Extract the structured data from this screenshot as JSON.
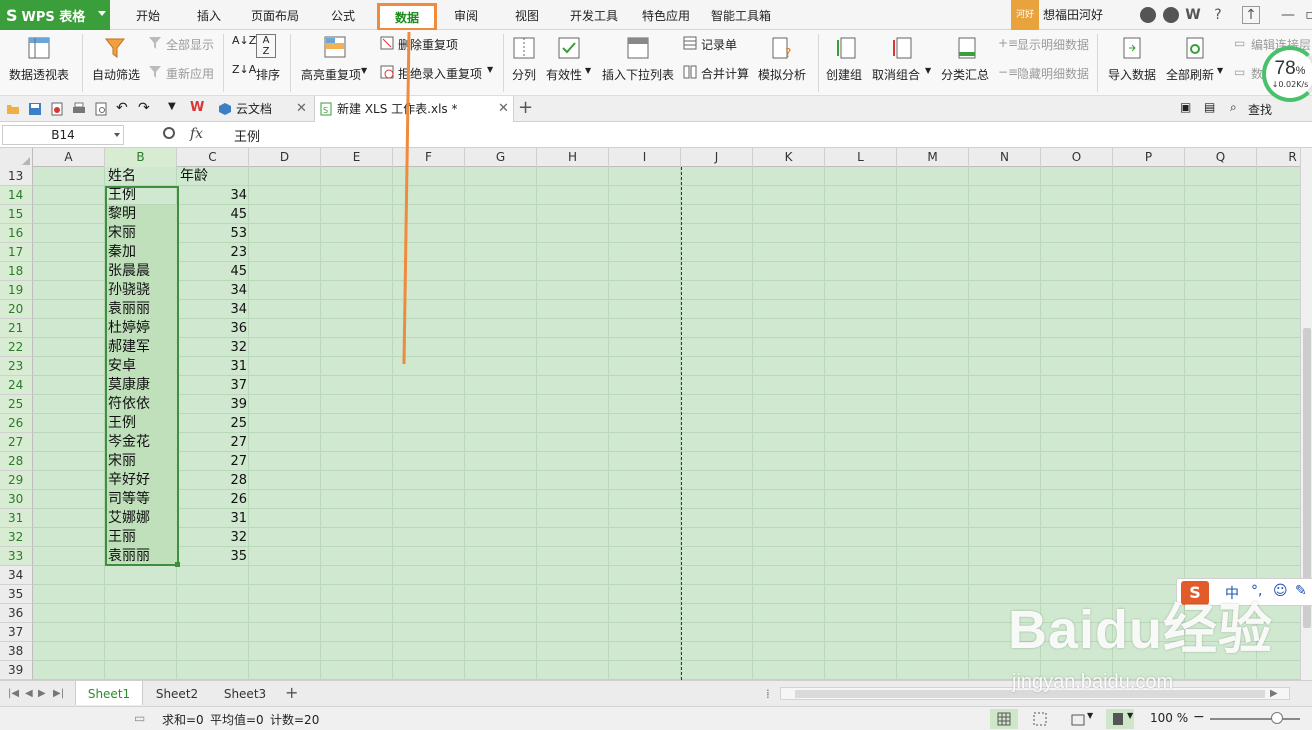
{
  "app": {
    "name": "WPS 表格",
    "menu_tabs": [
      "开始",
      "插入",
      "页面布局",
      "公式",
      "数据",
      "审阅",
      "视图",
      "开发工具",
      "特色应用",
      "智能工具箱"
    ],
    "active_tab": "数据",
    "user_badge": "河好",
    "user_name": "想福田河好"
  },
  "ribbon": {
    "pivot": "数据透视表",
    "autofilter": "自动筛选",
    "show_all": "全部显示",
    "reapply": "重新应用",
    "sort": "排序",
    "highlight_dup": "高亮重复项",
    "remove_dup": "删除重复项",
    "reject_dup": "拒绝录入重复项",
    "split": "分列",
    "validity": "有效性",
    "insert_dropdown": "插入下拉列表",
    "record": "记录单",
    "consolidate": "合并计算",
    "what_if": "模拟分析",
    "group": "创建组",
    "ungroup": "取消组合",
    "subtotal": "分类汇总",
    "show_detail": "显示明细数据",
    "hide_detail": "隐藏明细数据",
    "import": "导入数据",
    "refresh_all": "全部刷新",
    "edit_links": "编辑连接层",
    "data_more": "数",
    "find": "查找"
  },
  "doc_tabs": {
    "cloud": "云文档",
    "file": "新建 XLS 工作表.xls *"
  },
  "formula_bar": {
    "name_box": "B14",
    "fx": "fx",
    "value": "王例"
  },
  "grid": {
    "columns": [
      "A",
      "B",
      "C",
      "D",
      "E",
      "F",
      "G",
      "H",
      "I",
      "J",
      "K",
      "L",
      "M",
      "N",
      "O",
      "P",
      "Q",
      "R"
    ],
    "header_row": {
      "row": "13",
      "name": "姓名",
      "age": "年龄"
    },
    "rows": [
      {
        "row": "14",
        "name": "王例",
        "age": "34"
      },
      {
        "row": "15",
        "name": "黎明",
        "age": "45"
      },
      {
        "row": "16",
        "name": "宋丽",
        "age": "53"
      },
      {
        "row": "17",
        "name": "秦加",
        "age": "23"
      },
      {
        "row": "18",
        "name": "张晨晨",
        "age": "45"
      },
      {
        "row": "19",
        "name": "孙骁骁",
        "age": "34"
      },
      {
        "row": "20",
        "name": "袁丽丽",
        "age": "34"
      },
      {
        "row": "21",
        "name": "杜婷婷",
        "age": "36"
      },
      {
        "row": "22",
        "name": "郝建军",
        "age": "32"
      },
      {
        "row": "23",
        "name": "安卓",
        "age": "31"
      },
      {
        "row": "24",
        "name": "莫康康",
        "age": "37"
      },
      {
        "row": "25",
        "name": "符依依",
        "age": "39"
      },
      {
        "row": "26",
        "name": "王例",
        "age": "25"
      },
      {
        "row": "27",
        "name": "岑金花",
        "age": "27"
      },
      {
        "row": "28",
        "name": "宋丽",
        "age": "27"
      },
      {
        "row": "29",
        "name": "辛好好",
        "age": "28"
      },
      {
        "row": "30",
        "name": "司等等",
        "age": "26"
      },
      {
        "row": "31",
        "name": "艾娜娜",
        "age": "31"
      },
      {
        "row": "32",
        "name": "王丽",
        "age": "32"
      },
      {
        "row": "33",
        "name": "袁丽丽",
        "age": "35"
      }
    ],
    "empty_rows": [
      "34",
      "35",
      "36",
      "37",
      "38",
      "39"
    ]
  },
  "sheets": [
    "Sheet1",
    "Sheet2",
    "Sheet3"
  ],
  "active_sheet": "Sheet1",
  "status": {
    "sum": "求和=0",
    "avg": "平均值=0",
    "count": "计数=20",
    "zoom": "100 %"
  },
  "speed_widget": {
    "percent": "78",
    "unit": "%",
    "rate": "↓0.02K/s"
  },
  "ime": {
    "lang": "中"
  },
  "watermark": {
    "text": "Baidu经验",
    "url": "jingyan.baidu.com"
  },
  "colors": {
    "accent": "#3a9e3a",
    "highlight": "#f08a3c",
    "sheet_bg": "#cfe8cf"
  }
}
